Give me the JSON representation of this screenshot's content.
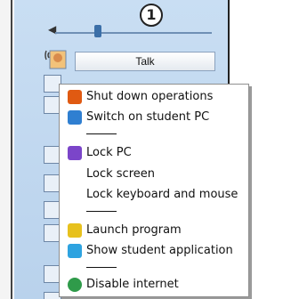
{
  "badge": "1",
  "toolbar": {
    "talk_label": "Talk"
  },
  "menu": {
    "items": [
      {
        "label": "Shut down operations",
        "icon": "power-icon",
        "color": "#e05a12"
      },
      {
        "label": "Switch on student PC",
        "icon": "monitor-icon",
        "color": "#2f7fd1"
      },
      {
        "label": "Lock PC",
        "icon": "lock-icon",
        "color": "#7b45c9"
      },
      {
        "label": "Lock screen"
      },
      {
        "label": "Lock keyboard and mouse"
      },
      {
        "label": "Launch program",
        "icon": "folder-icon",
        "color": "#e7c11d"
      },
      {
        "label": "Show student application",
        "icon": "window-icon",
        "color": "#2ea3e0"
      },
      {
        "label": "Disable internet",
        "icon": "globe-icon",
        "color": "#2f9b4a"
      }
    ]
  }
}
